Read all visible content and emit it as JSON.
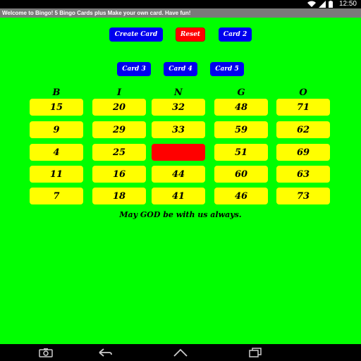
{
  "status_bar": {
    "time": "12:50"
  },
  "title_bar": {
    "text": "Welcome to Bingo! 5 Bingo Cards plus Make your own card. Have fun!"
  },
  "buttons": {
    "create_card": "Create Card",
    "reset": "Reset",
    "card2": "Card 2",
    "card3": "Card 3",
    "card4": "Card 4",
    "card5": "Card 5"
  },
  "colors": {
    "background": "#00ff00",
    "button_blue": "#0000ee",
    "cell_yellow": "#ffff00",
    "free_red": "#ff0000"
  },
  "bingo": {
    "headers": [
      "B",
      "I",
      "N",
      "G",
      "O"
    ],
    "rows": [
      [
        "15",
        "20",
        "32",
        "48",
        "71"
      ],
      [
        "9",
        "29",
        "33",
        "59",
        "62"
      ],
      [
        "4",
        "25",
        "",
        "51",
        "69"
      ],
      [
        "11",
        "16",
        "44",
        "60",
        "63"
      ],
      [
        "7",
        "18",
        "41",
        "46",
        "73"
      ]
    ]
  },
  "motto": "May GOD be with us always.",
  "nav": {
    "icons": [
      "camera-icon",
      "back-icon",
      "home-icon",
      "recent-apps-icon"
    ]
  }
}
